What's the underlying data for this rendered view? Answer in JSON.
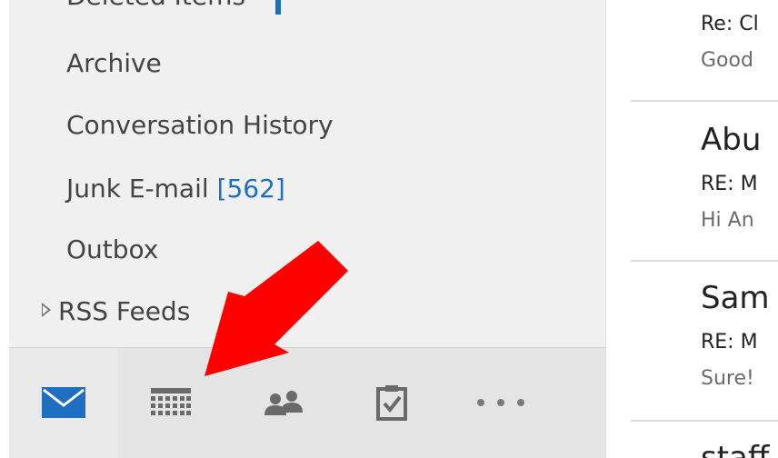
{
  "folders": {
    "deleted_items": {
      "label": "Deleted Items"
    },
    "archive": {
      "label": "Archive"
    },
    "conversation_history": {
      "label": "Conversation History"
    },
    "junk": {
      "label": "Junk E-mail",
      "count": "[562]"
    },
    "outbox": {
      "label": "Outbox"
    },
    "rss_feeds": {
      "label": "RSS Feeds"
    }
  },
  "nav": {
    "icons": [
      "mail-icon",
      "calendar-icon",
      "people-icon",
      "tasks-icon",
      "more-icon"
    ],
    "more_label": "•••"
  },
  "messages": [
    {
      "sender": "",
      "subject": "Re: Cl",
      "preview": "Good"
    },
    {
      "sender": "Abu",
      "subject": "RE: M",
      "preview": "Hi An"
    },
    {
      "sender": "Sam",
      "subject": "RE: M",
      "preview": "Sure!"
    },
    {
      "sender": "staff",
      "subject": "",
      "preview": ""
    }
  ],
  "colors": {
    "accent_blue": "#1e6fc1",
    "pane_bg": "#f0f0f0",
    "nav_bg": "#e4e4e4",
    "arrow_red": "#ff0000"
  }
}
